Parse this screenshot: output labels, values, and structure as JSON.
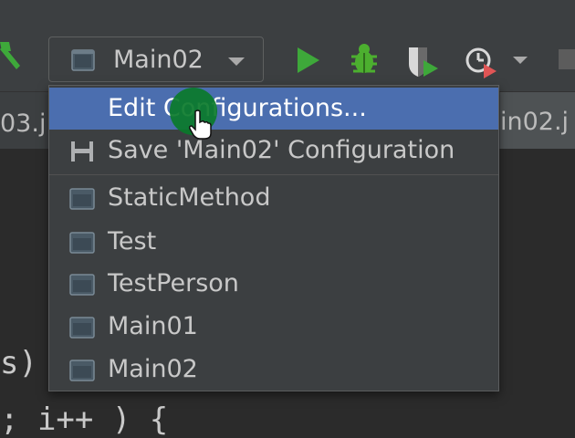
{
  "toolbar": {
    "run_config": {
      "label": "Main02"
    }
  },
  "tabs": {
    "left_label": "03.j",
    "right_label": "in02.j"
  },
  "code": {
    "line_params": "s)",
    "line_loop": "; i++ ) {"
  },
  "dropdown": {
    "items": [
      {
        "label": "Edit Configurations...",
        "icon": "none",
        "selected": true
      },
      {
        "label": "Save 'Main02' Configuration",
        "icon": "save-icon",
        "selected": false
      },
      {
        "label": "StaticMethod",
        "icon": "application-config-icon",
        "selected": false
      },
      {
        "label": "Test",
        "icon": "application-config-icon",
        "selected": false
      },
      {
        "label": "TestPerson",
        "icon": "application-config-icon",
        "selected": false
      },
      {
        "label": "Main01",
        "icon": "application-config-icon",
        "selected": false
      },
      {
        "label": "Main02",
        "icon": "application-config-icon",
        "selected": false
      }
    ]
  },
  "colors": {
    "selection": "#4b6eaf",
    "run_green": "#3ea83a",
    "debug_green": "#4caf2f",
    "cursor_highlight": "#0a7a2a"
  }
}
